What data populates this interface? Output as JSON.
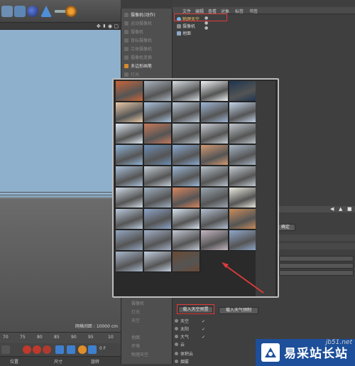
{
  "toolbar": {
    "icons": [
      "render-view-icon",
      "render-icon",
      "render-settings-icon",
      "sphere-icon",
      "shape-icon",
      "light-icon",
      "separator",
      "deformer-icon"
    ]
  },
  "viewport": {
    "status_text": "网格间距 : 10000 cm"
  },
  "timeline": {
    "ticks": [
      "70",
      "75",
      "80",
      "85",
      "90",
      "95",
      "10"
    ],
    "frame": "0 F"
  },
  "coords": {
    "position_label": "位置",
    "size_label": "尺寸",
    "rotation_label": "旋转"
  },
  "create_menu": {
    "items": [
      {
        "label": "摄像机(动作)",
        "active": true
      },
      {
        "label": "运动摄像机",
        "active": false
      },
      {
        "label": "摄像机",
        "active": false
      },
      {
        "label": "目标摄像机",
        "active": false
      },
      {
        "label": "立体摄像机",
        "active": false
      },
      {
        "label": "摄像机变换",
        "active": false
      },
      {
        "label": "多边形画笔",
        "active": true
      },
      {
        "label": "灯光",
        "active": false
      }
    ],
    "lower_items": [
      {
        "label": "摄像机",
        "active": false
      },
      {
        "label": "灯光",
        "active": false
      },
      {
        "label": "天空",
        "active": false
      },
      {
        "label": "地面",
        "active": false
      },
      {
        "label": "环境",
        "active": false
      },
      {
        "label": "物理天空",
        "active": false
      }
    ]
  },
  "object_manager": {
    "menus": [
      "文件",
      "编辑",
      "查看",
      "对象",
      "标签",
      "书签"
    ],
    "objects": [
      {
        "label": "物理天空"
      },
      {
        "label": "摄像机"
      },
      {
        "label": "地面"
      }
    ]
  },
  "attributes": {
    "load_preset_button": "载入天空预置",
    "save_preset_button": "载入天气预制",
    "small_button": "确定",
    "rows": [
      {
        "label": "天空",
        "checked": true
      },
      {
        "label": "太阳",
        "checked": true
      },
      {
        "label": "大气",
        "checked": true
      },
      {
        "label": "云",
        "checked": false
      }
    ],
    "extra_rows": [
      {
        "label": "体积云"
      },
      {
        "label": "烟雾"
      }
    ]
  },
  "sky_presets": {
    "thumbnails": [
      "#c9653a",
      "#aab4bf",
      "#d7dde2",
      "#eef1f4",
      "#1d3550",
      "#e9c8a8",
      "#a9c2de",
      "#b9c7d8",
      "#9fb6d6",
      "#c2d4ea",
      "#dfe9f3",
      "#c77a5c",
      "#b8c2cb",
      "#c9cfd6",
      "#c0c7ce",
      "#8fb4d8",
      "#6d8fb6",
      "#8aaad0",
      "#d29a73",
      "#a7b7c8",
      "#a8bfd9",
      "#c3cdd6",
      "#9bb6d4",
      "#b7c2cc",
      "#c4ccd3",
      "#cfd9e4",
      "#9fb0c2",
      "#d9855f",
      "#9aa6b0",
      "#ecebe0",
      "#b9c9dd",
      "#8da4c8",
      "#d7e2ee",
      "#b3bfd1",
      "#c98d5a",
      "#93a6c1",
      "#a3b0c7",
      "#c2c7d4",
      "#c4b6c2",
      "#8ea8cb",
      "#a8b6cc",
      "#c3cee0",
      "#6a4a35"
    ]
  },
  "watermark": {
    "url": "jb51.net",
    "brand": "易采站长站"
  }
}
